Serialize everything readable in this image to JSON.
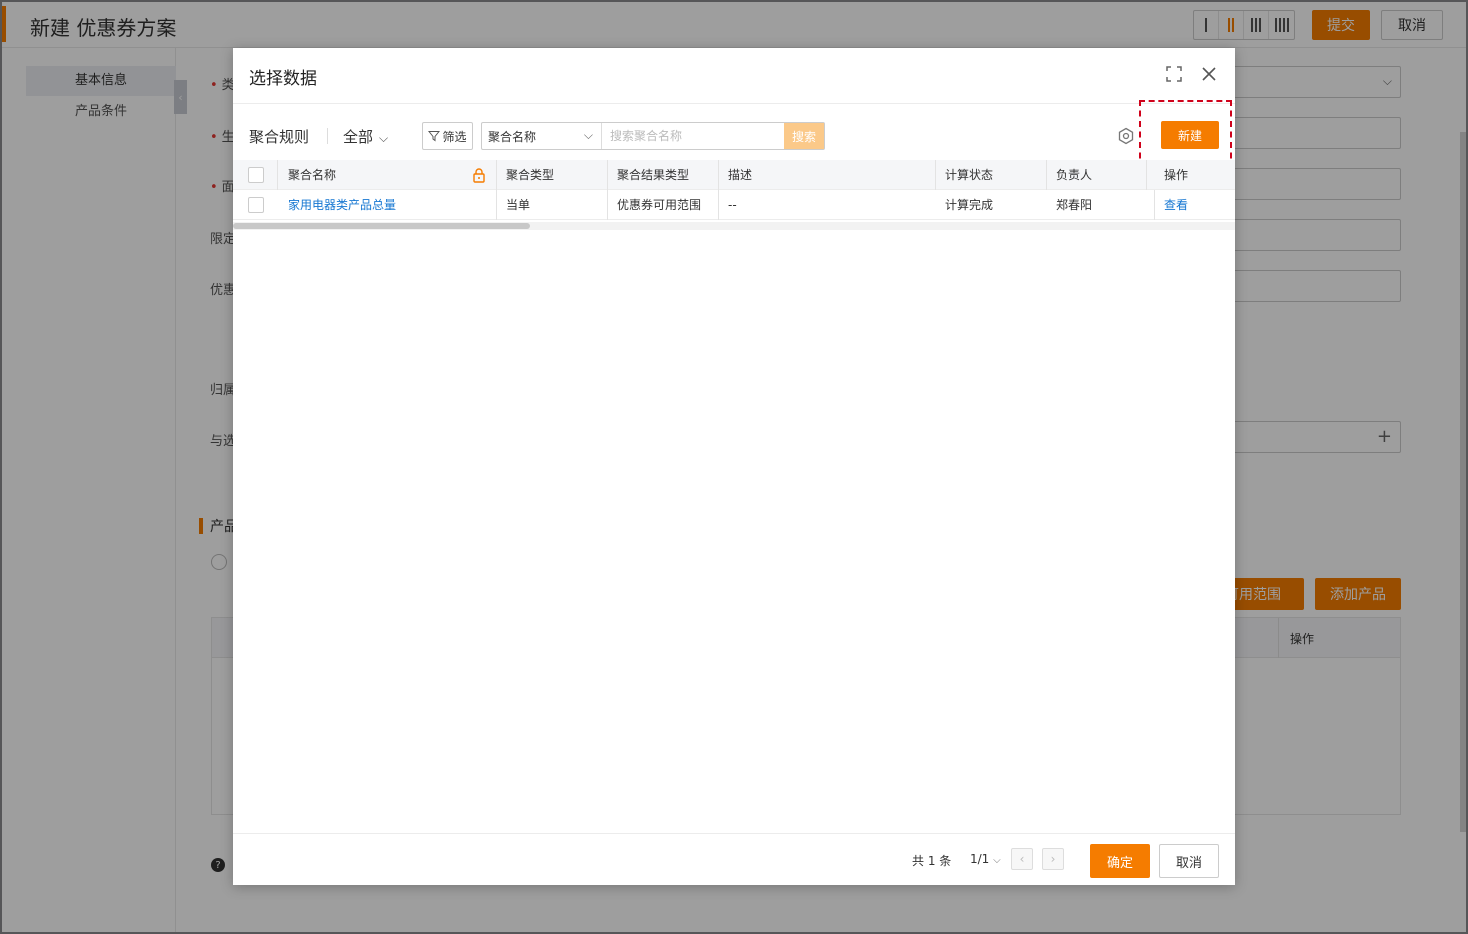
{
  "background": {
    "title": "新建 优惠券方案",
    "submit_label": "提交",
    "cancel_label": "取消",
    "sidebar": {
      "items": [
        {
          "label": "基本信息"
        },
        {
          "label": "产品条件"
        }
      ]
    },
    "form_labels": [
      "类",
      "生",
      "面",
      "限定",
      "优惠",
      "归属",
      "与选"
    ],
    "section_title": "产品",
    "range_button_label": "可用范围",
    "add_product_label": "添加产品",
    "table_op_label": "操作"
  },
  "modal": {
    "title": "选择数据",
    "toolbar": {
      "object_label": "聚合规则",
      "view_label": "全部",
      "filter_label": "筛选",
      "search_field": "聚合名称",
      "search_placeholder": "搜索聚合名称",
      "search_button": "搜索",
      "new_button": "新建"
    },
    "table": {
      "columns": [
        "聚合名称",
        "聚合类型",
        "聚合结果类型",
        "描述",
        "计算状态",
        "负责人",
        "操作"
      ],
      "rows": [
        {
          "name": "家用电器类产品总量",
          "type": "当单",
          "result_type": "优惠券可用范围",
          "description": "--",
          "status": "计算完成",
          "owner": "郑春阳",
          "action": "查看"
        }
      ]
    },
    "footer": {
      "total": "共 1 条",
      "page": "1/1",
      "ok_label": "确定",
      "cancel_label": "取消"
    }
  },
  "colors": {
    "accent": "#f57c00",
    "link": "#1677d2",
    "highlight": "#d0021b"
  }
}
